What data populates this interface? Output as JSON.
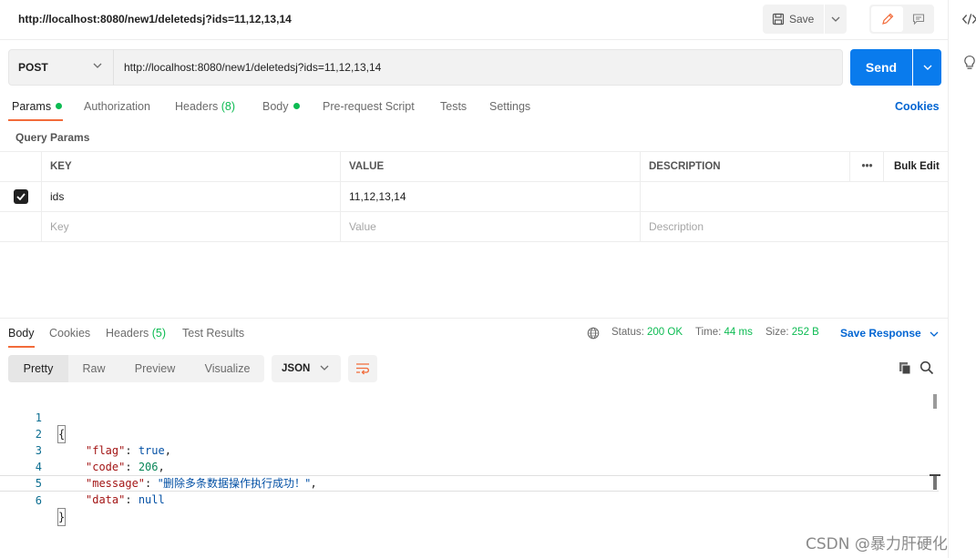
{
  "title": {
    "url": "http://localhost:8080/new1/deletedsj?ids=11,12,13,14"
  },
  "toolbar": {
    "save_label": "Save"
  },
  "request": {
    "method": "POST",
    "url": "http://localhost:8080/new1/deletedsj?ids=11,12,13,14",
    "send_label": "Send"
  },
  "request_tabs": [
    {
      "label": "Params"
    },
    {
      "label": "Authorization"
    },
    {
      "label": "Headers",
      "count": "(8)"
    },
    {
      "label": "Body"
    },
    {
      "label": "Pre-request Script"
    },
    {
      "label": "Tests"
    },
    {
      "label": "Settings"
    }
  ],
  "cookies_label": "Cookies",
  "query_params": {
    "title": "Query Params",
    "headers": {
      "key": "KEY",
      "value": "VALUE",
      "description": "DESCRIPTION",
      "more": "•••",
      "bulk_edit": "Bulk Edit"
    },
    "rows": [
      {
        "key": "ids",
        "value": "11,12,13,14",
        "description": "",
        "checked": true
      }
    ],
    "placeholders": {
      "key": "Key",
      "value": "Value",
      "description": "Description"
    }
  },
  "response_tabs": [
    {
      "label": "Body"
    },
    {
      "label": "Cookies"
    },
    {
      "label": "Headers",
      "count": "(5)"
    },
    {
      "label": "Test Results"
    }
  ],
  "status": {
    "status_label": "Status:",
    "status_value": "200 OK",
    "time_label": "Time:",
    "time_value": "44 ms",
    "size_label": "Size:",
    "size_value": "252 B",
    "save_response": "Save Response"
  },
  "view_modes": [
    "Pretty",
    "Raw",
    "Preview",
    "Visualize"
  ],
  "format": "JSON",
  "code": {
    "line_numbers": [
      "1",
      "2",
      "3",
      "4",
      "5",
      "6"
    ],
    "open": "{",
    "close": "}",
    "entries": [
      {
        "key": "\"flag\"",
        "value": "true"
      },
      {
        "key": "\"code\"",
        "value": "206"
      },
      {
        "key": "\"message\"",
        "value": "\"删除多条数据操作执行成功！\""
      },
      {
        "key": "\"data\"",
        "value": "null"
      }
    ]
  },
  "watermark": "CSDN @暴力肝硬化",
  "colors": {
    "accent": "#f26b3a",
    "primary": "#097bed",
    "success": "#0cbb52",
    "link": "#0265d2"
  }
}
